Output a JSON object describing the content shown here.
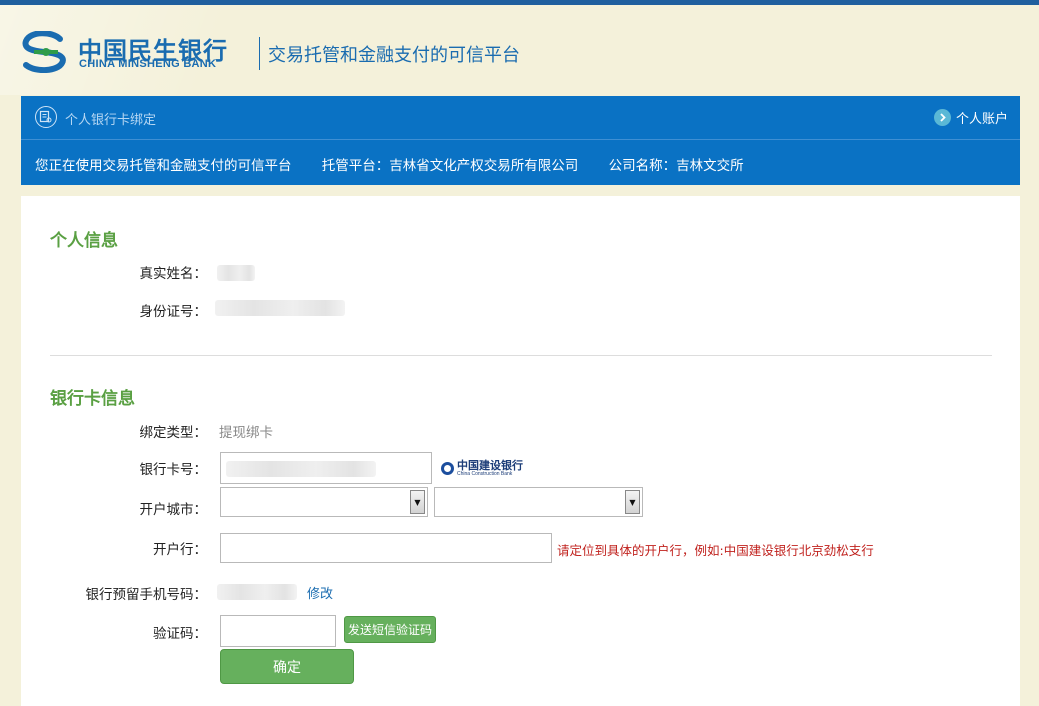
{
  "header": {
    "bank_name_cn": "中国民生银行",
    "bank_name_en": "CHINA MINSHENG BANK",
    "platform_title": "交易托管和金融支付的可信平台"
  },
  "bluebar": {
    "page_title": "个人银行卡绑定",
    "account_link": "个人账户",
    "info_platform": "您正在使用交易托管和金融支付的可信平台",
    "info_custody": "托管平台：吉林省文化产权交易所有限公司",
    "info_company": "公司名称：吉林文交所"
  },
  "personal": {
    "section_title": "个人信息",
    "name_label": "真实姓名：",
    "id_label": "身份证号："
  },
  "bankcard": {
    "section_title": "银行卡信息",
    "bind_type_label": "绑定类型：",
    "bind_type_value": "提现绑卡",
    "card_no_label": "银行卡号：",
    "bank_logo_cn": "中国建设银行",
    "bank_logo_en": "China Construction Bank",
    "city_label": "开户城市：",
    "branch_label": "开户行：",
    "branch_hint": "请定位到具体的开户行，例如:中国建设银行北京劲松支行",
    "phone_label": "银行预留手机号码：",
    "modify_label": "修改",
    "code_label": "验证码：",
    "send_sms_label": "发送短信验证码",
    "confirm_label": "确定"
  },
  "icons": {
    "account_arrow": "chevron-right-circle-icon",
    "card_bind": "card-bind-icon",
    "select_arrow": "caret-down-icon"
  },
  "colors": {
    "brand_blue": "#0a72c4",
    "section_green": "#5aa043",
    "button_green": "#66b05d",
    "hint_red": "#c0221e"
  }
}
